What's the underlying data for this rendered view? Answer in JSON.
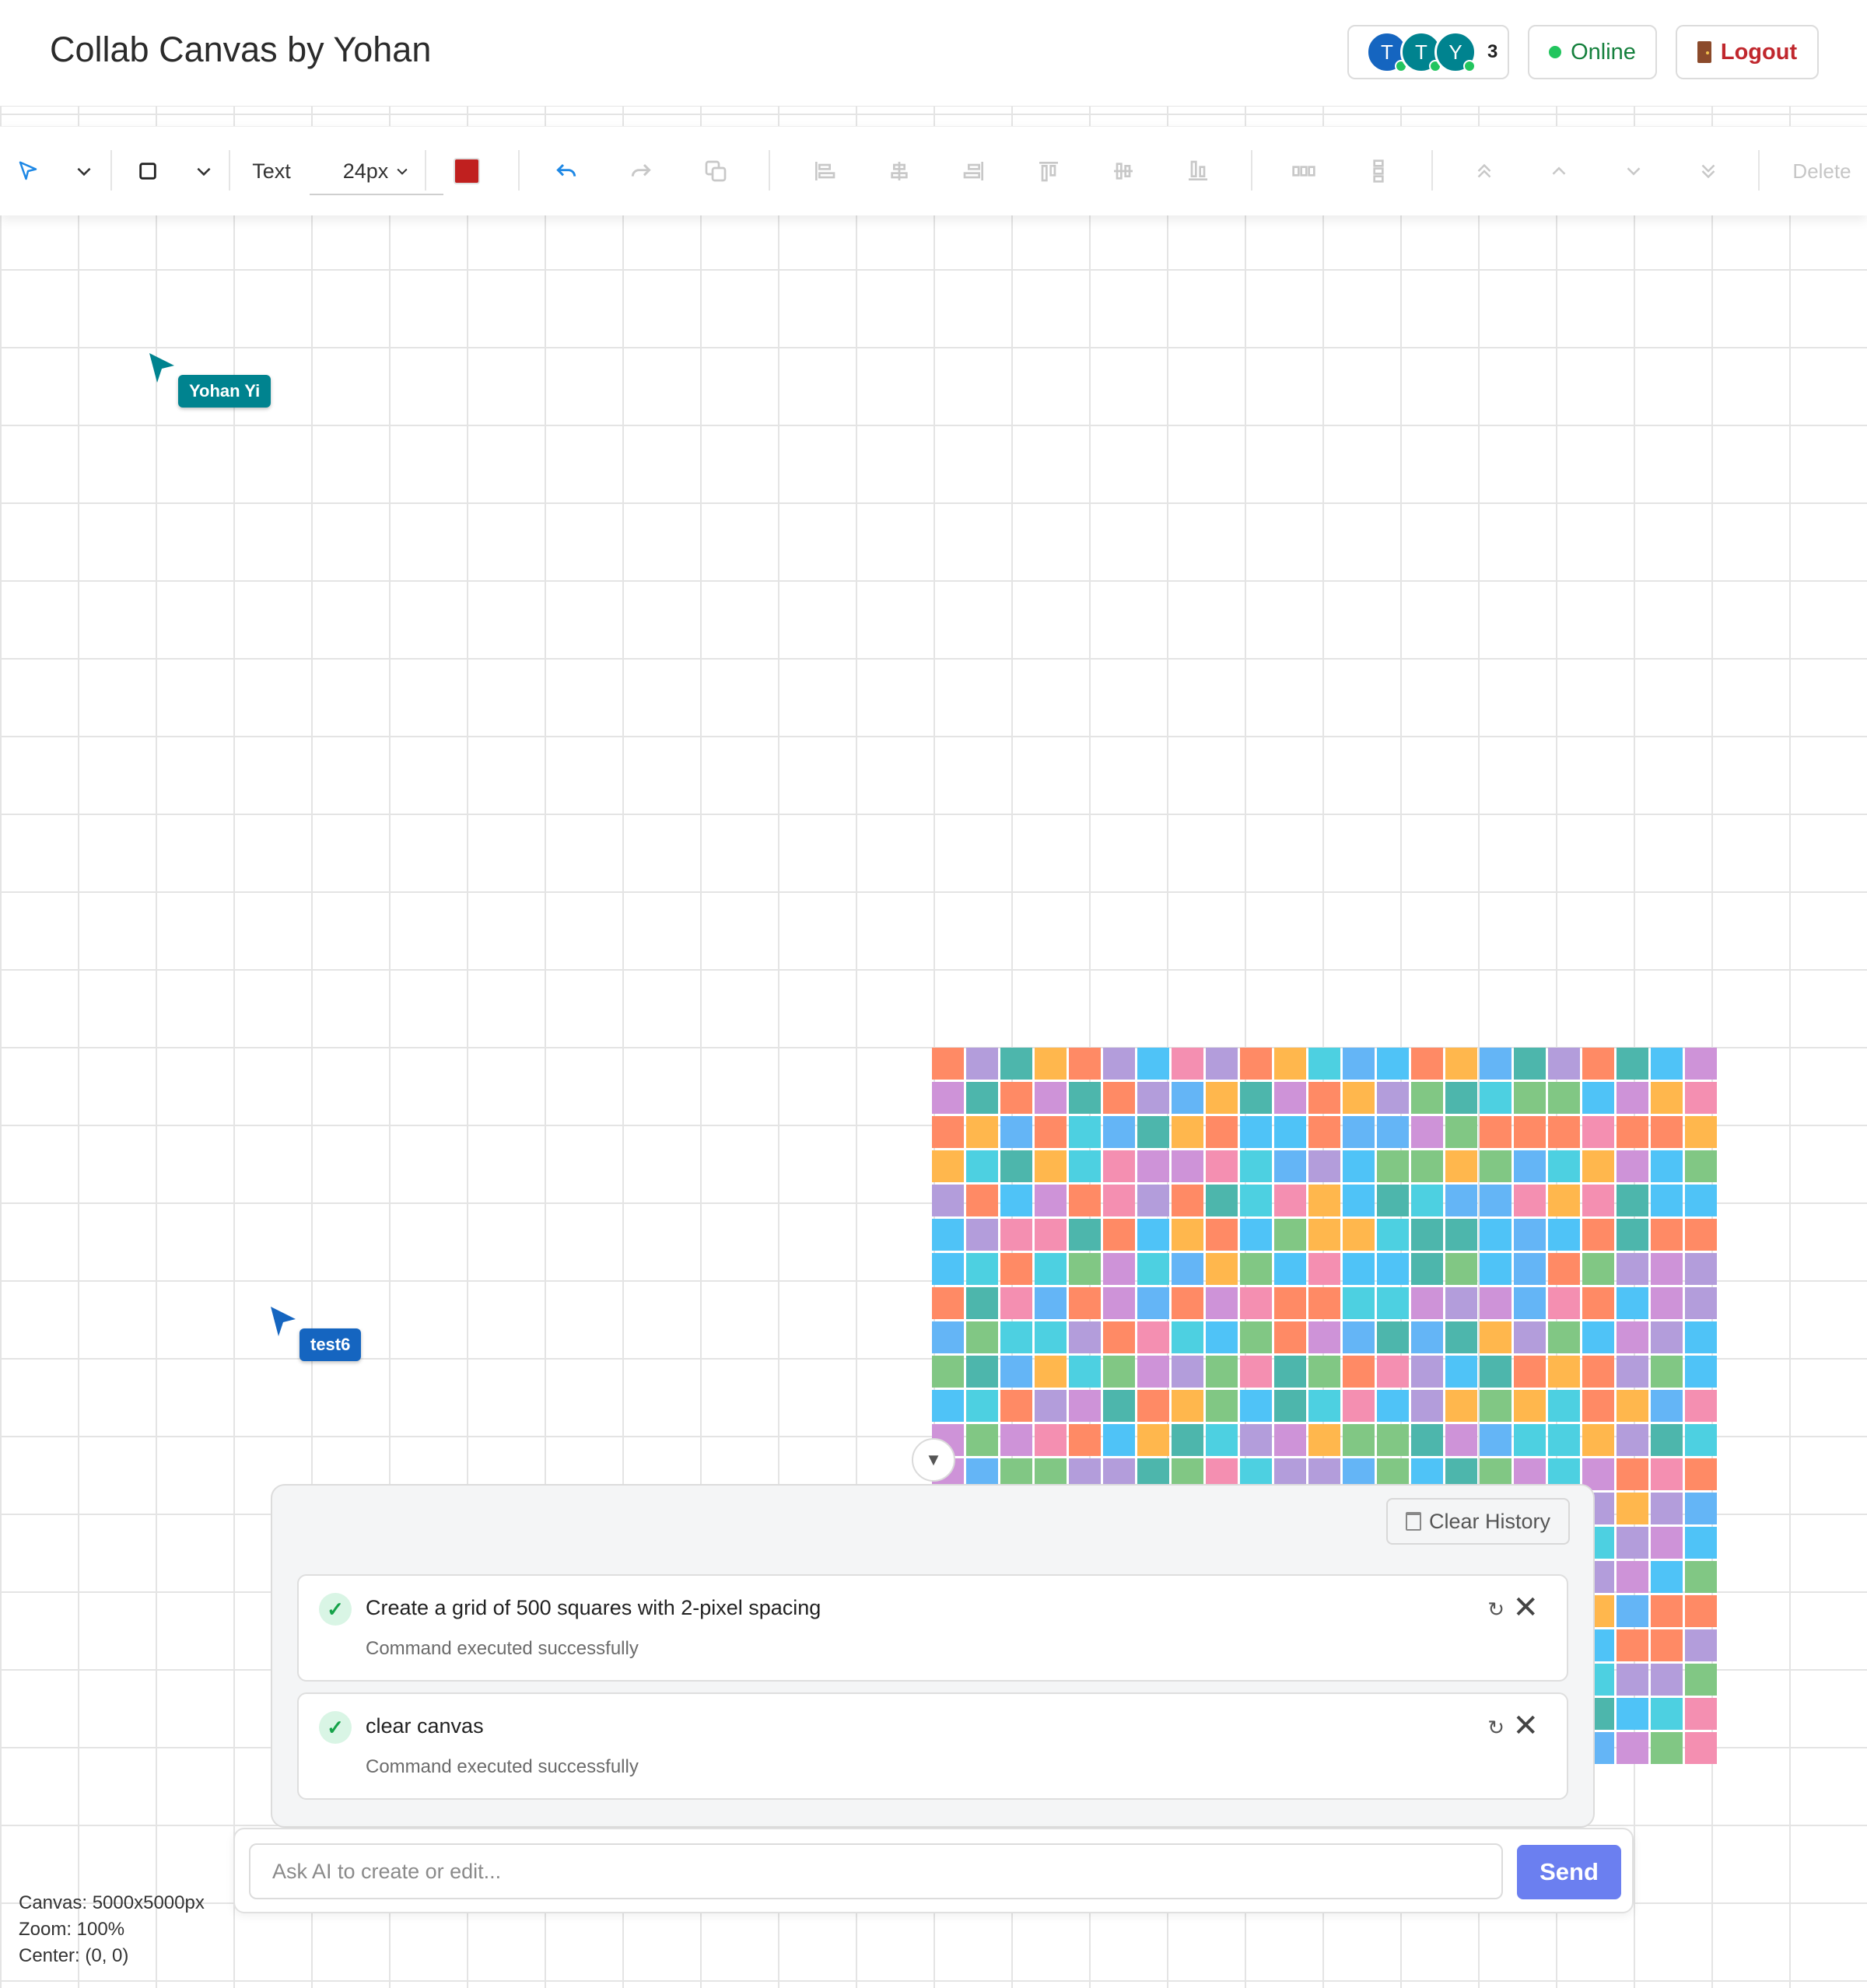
{
  "header": {
    "title": "Collab Canvas by Yohan",
    "presence": {
      "avatars": [
        {
          "initial": "T",
          "color": "#1565c0"
        },
        {
          "initial": "T",
          "color": "#00838f"
        },
        {
          "initial": "Y",
          "color": "#00838f"
        }
      ],
      "count": "3"
    },
    "status_label": "Online",
    "logout_label": "Logout"
  },
  "toolbar": {
    "select_tool_icon": "cursor-arrow-icon",
    "shape_tool_icon": "square-icon",
    "text_label": "Text",
    "font_size": "24px",
    "current_color": "#c0201f",
    "delete_label": "Delete"
  },
  "cursors": [
    {
      "name": "Yohan Yi",
      "color": "#00838f"
    },
    {
      "name": "test6",
      "color": "#1565c0"
    }
  ],
  "palette": [
    "#4fc3f7",
    "#4db6ac",
    "#ffb74d",
    "#81c784",
    "#ff8a65",
    "#b39ddb",
    "#64b5f6",
    "#4dd0e1",
    "#f48fb1",
    "#ce93d8"
  ],
  "history": {
    "clear_label": "Clear History",
    "items": [
      {
        "command": "Create a grid of 500 squares with 2-pixel spacing",
        "status": "Command executed successfully"
      },
      {
        "command": "clear canvas",
        "status": "Command executed successfully"
      }
    ]
  },
  "ai_input": {
    "placeholder": "Ask AI to create or edit...",
    "value": "",
    "send_label": "Send"
  },
  "canvas_info": {
    "canvas": "Canvas: 5000x5000px",
    "zoom": "Zoom: 100%",
    "center": "Center: (0, 0)"
  }
}
